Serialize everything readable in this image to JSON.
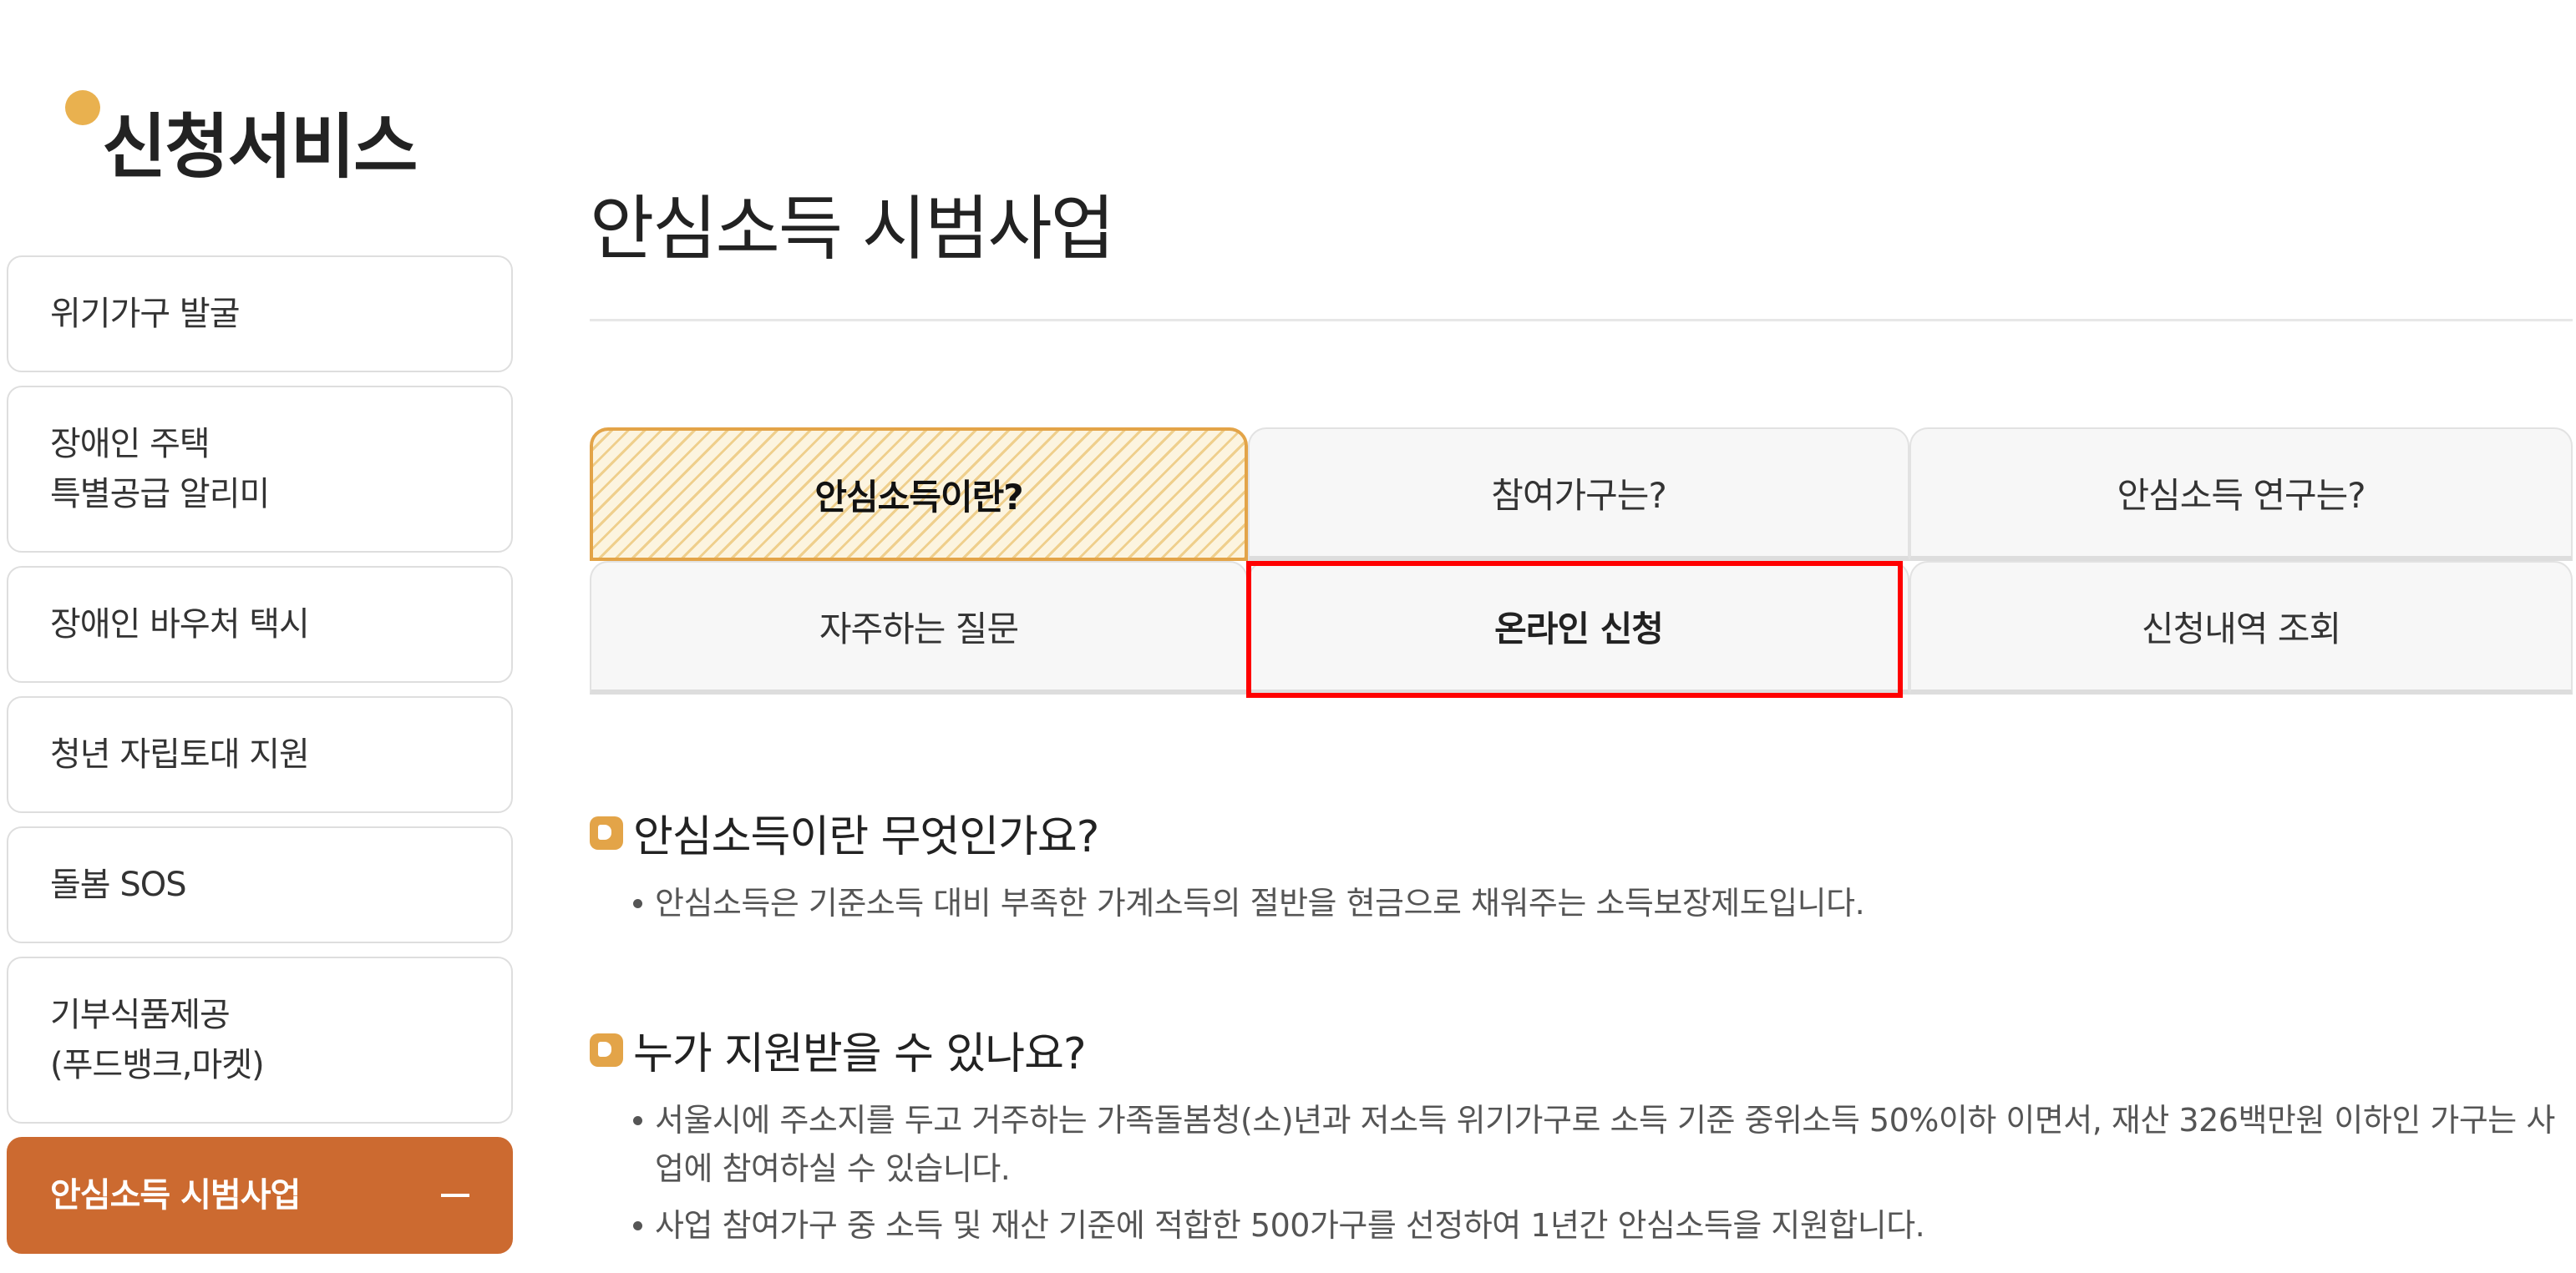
{
  "sidebar": {
    "title": "신청서비스",
    "items": [
      {
        "label": "위기가구 발굴"
      },
      {
        "label": "장애인 주택\n특별공급 알리미"
      },
      {
        "label": "장애인 바우처 택시"
      },
      {
        "label": "청년 자립토대 지원"
      },
      {
        "label": "돌봄 SOS"
      },
      {
        "label": "기부식품제공\n(푸드뱅크,마켓)"
      },
      {
        "label": "안심소득 시범사업",
        "active": true
      }
    ]
  },
  "main": {
    "title": "안심소득 시범사업",
    "tabs": [
      {
        "label": "안심소득이란?"
      },
      {
        "label": "참여가구는?"
      },
      {
        "label": "안심소득 연구는?"
      },
      {
        "label": "자주하는 질문"
      },
      {
        "label": "온라인 신청"
      },
      {
        "label": "신청내역 조회"
      }
    ],
    "sections": [
      {
        "heading": "안심소득이란 무엇인가요?",
        "bullets": [
          "안심소득은 기준소득 대비 부족한 가계소득의 절반을 현금으로 채워주는 소득보장제도입니다."
        ]
      },
      {
        "heading": "누가 지원받을 수 있나요?",
        "bullets": [
          "서울시에 주소지를 두고 거주하는 가족돌봄청(소)년과 저소득 위기가구로 소득 기준 중위소득 50%이하 이면서, 재산 326백만원 이하인 가구는 사업에 참여하실 수 있습니다.",
          "사업 참여가구 중 소득 및 재산 기준에 적합한 500가구를 선정하여 1년간 안심소득을 지원합니다."
        ]
      }
    ]
  },
  "colors": {
    "accent": "#cc6a30",
    "gold": "#e3a448",
    "highlight": "#ff0000"
  }
}
